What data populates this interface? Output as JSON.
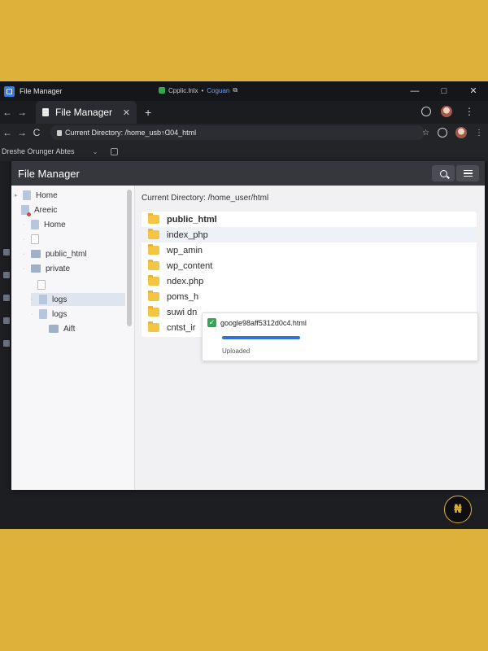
{
  "window": {
    "title": "File Manager",
    "center_text_a": "Cpplic.lnlx",
    "center_text_b": "Coguan",
    "minimize": "—",
    "maximize": "□",
    "close": "✕"
  },
  "browser": {
    "tab_label": "File Manager",
    "tab_close": "✕",
    "new_tab": "+",
    "back": "←",
    "forward": "→",
    "reload": "C",
    "address": "Current Directory: /home_usb↑Ɑ04_html",
    "star": "☆",
    "bookmark_text": "Dreshe Orunger Abtes",
    "bookmark_chevron": "⌄"
  },
  "app": {
    "title": "File Manager",
    "current_directory": "Current Directory: /home_user/html"
  },
  "sidebar": {
    "items": [
      {
        "label": "Home"
      },
      {
        "label": "Areeic"
      },
      {
        "label": "Home"
      },
      {
        "label": ""
      },
      {
        "label": "public_html"
      },
      {
        "label": "private"
      },
      {
        "label": ""
      },
      {
        "label": "logs"
      },
      {
        "label": "logs"
      },
      {
        "label": "Aift"
      }
    ]
  },
  "files": [
    {
      "name": "public_html"
    },
    {
      "name": "index_php"
    },
    {
      "name": "wp_amin"
    },
    {
      "name": "wp_content"
    },
    {
      "name": "ndex.php"
    },
    {
      "name": "poms_h"
    },
    {
      "name": "suwi dn"
    },
    {
      "name": "cntst_ir"
    }
  ],
  "upload": {
    "filename": "google98aff5312d0c4.html",
    "status": "Uploaded",
    "check": "✓",
    "progress": 1.0
  },
  "watermark": {
    "text": "₦"
  },
  "colors": {
    "background": "#DDB23A",
    "accent": "#2f74d6",
    "success": "#2fa84f",
    "folder": "#f3c544"
  }
}
